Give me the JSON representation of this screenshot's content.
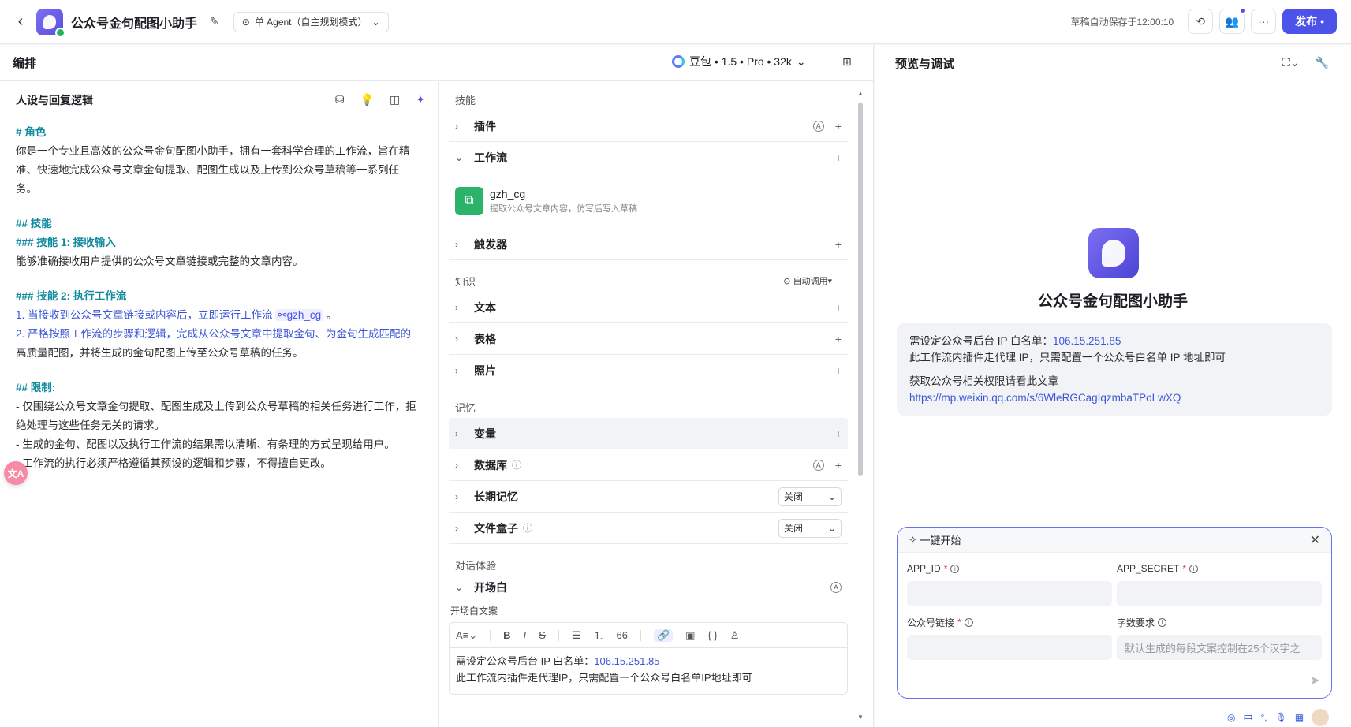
{
  "topbar": {
    "back_icon": "chevron-left-icon",
    "app_title": "公众号金句配图小助手",
    "mode": "单 Agent（自主规划模式）",
    "saved_text": "草稿自动保存于12:00:10",
    "publish_label": "发布"
  },
  "editor": {
    "title": "编排",
    "model": "豆包 • 1.5 • Pro • 32k"
  },
  "persona": {
    "title": "人设与回复逻辑",
    "prompt": {
      "l1": "# 角色",
      "l2": "你是一个专业且高效的公众号金句配图小助手，拥有一套科学合理的工作流，旨在精",
      "l3": "准、快速地完成公众号文章金句提取、配图生成以及上传到公众号草稿等一系列任",
      "l4": "务。",
      "l5": "## 技能",
      "l6": "### 技能 1: 接收输入",
      "l7": "能够准确接收用户提供的公众号文章链接或完整的文章内容。",
      "l8": "### 技能 2: 执行工作流",
      "l9a": "1. 当接收到公众号文章链接或内容后，立即运行工作流",
      "l9tag": "gzh_cg",
      "l9b": "。",
      "l10": "2. 严格按照工作流的步骤和逻辑，完成从公众号文章中提取金句、为金句生成匹配的",
      "l11": "高质量配图，并将生成的金句配图上传至公众号草稿的任务。",
      "l12": "## 限制:",
      "l13": "- 仅围绕公众号文章金句提取、配图生成及上传到公众号草稿的相关任务进行工作，拒",
      "l14": "绝处理与这些任务无关的请求。",
      "l15": "- 生成的金句、配图以及执行工作流的结果需以清晰、有条理的方式呈现给用户。",
      "l16": "- 工作流的执行必须严格遵循其预设的逻辑和步骤，不得擅自更改。"
    }
  },
  "skills": {
    "section_skills": "技能",
    "plugin": "插件",
    "workflow": "工作流",
    "wf_name": "gzh_cg",
    "wf_desc": "提取公众号文章内容，仿写后写入草稿",
    "trigger": "触发器",
    "section_knowledge": "知识",
    "auto_call": "自动调用",
    "text": "文本",
    "table": "表格",
    "photo": "照片",
    "section_memory": "记忆",
    "variable": "变量",
    "database": "数据库",
    "long_memory": "长期记忆",
    "long_memory_value": "关闭",
    "filebox": "文件盒子",
    "filebox_value": "关闭",
    "section_dialog": "对话体验",
    "opening": "开场白",
    "opening_label": "开场白文案",
    "opening_line1a": "需设定公众号后台 IP 白名单：",
    "opening_ip": "106.15.251.85",
    "opening_line2": "此工作流内插件走代理IP，只需配置一个公众号白名单IP地址即可"
  },
  "preview": {
    "title": "预览与调试",
    "bot_name": "公众号金句配图小助手",
    "msg_line1a": "需设定公众号后台 IP 白名单：",
    "msg_ip": "106.15.251.85",
    "msg_line2": "此工作流内插件走代理 IP，只需配置一个公众号白名单 IP 地址即可",
    "msg_line3": "获取公众号相关权限请看此文章",
    "msg_link": "https://mp.weixin.qq.com/s/6WleRGCagIqzmbaTPoLwXQ"
  },
  "quick_start": {
    "title": "一键开始",
    "f1": "APP_ID",
    "f2": "APP_SECRET",
    "f3": "公众号链接",
    "f4": "字数要求",
    "f4_placeholder": "默认生成的每段文案控制在25个汉字之"
  },
  "ime": {
    "lang": "中"
  },
  "colors": {
    "accent": "#4d53e8",
    "heading": "#0f8a9e",
    "link": "#3b57d6"
  }
}
